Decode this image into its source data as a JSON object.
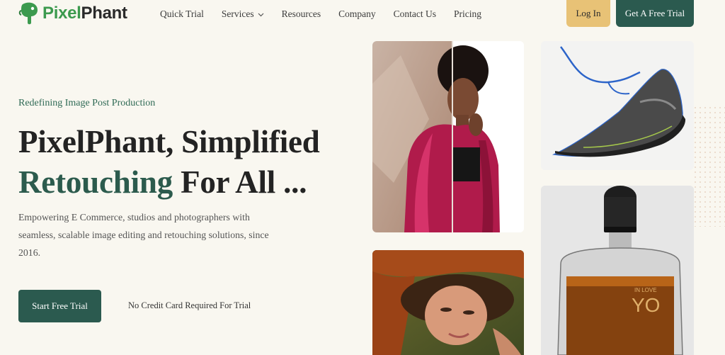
{
  "brand": {
    "name_part1": "Pixel",
    "name_part2": "Phant",
    "accent_color": "#3c9a4e"
  },
  "nav": {
    "items": [
      {
        "label": "Quick Trial"
      },
      {
        "label": "Services",
        "has_dropdown": true
      },
      {
        "label": "Resources"
      },
      {
        "label": "Company"
      },
      {
        "label": "Contact Us"
      },
      {
        "label": "Pricing"
      }
    ],
    "login_label": "Log In",
    "trial_label": "Get A Free Trial"
  },
  "hero": {
    "eyebrow": "Redefining Image Post Production",
    "title_line1": "PixelPhant, Simplified",
    "title_accent": "Retouching",
    "title_rest": " For All ...",
    "description": "Empowering E Commerce, studios and photographers with seamless, scalable image editing and retouching solutions, since 2016.",
    "cta_label": "Start Free Trial",
    "cta_note": "No Credit Card Required For Trial"
  },
  "colors": {
    "primary": "#2b5a4f",
    "login": "#e8c276",
    "background": "#f9f7f0"
  },
  "images": [
    {
      "name": "woman-before-after-photo"
    },
    {
      "name": "sneaker-clipping-path-photo"
    },
    {
      "name": "woman-lying-portrait-photo"
    },
    {
      "name": "perfume-bottle-photo"
    }
  ]
}
